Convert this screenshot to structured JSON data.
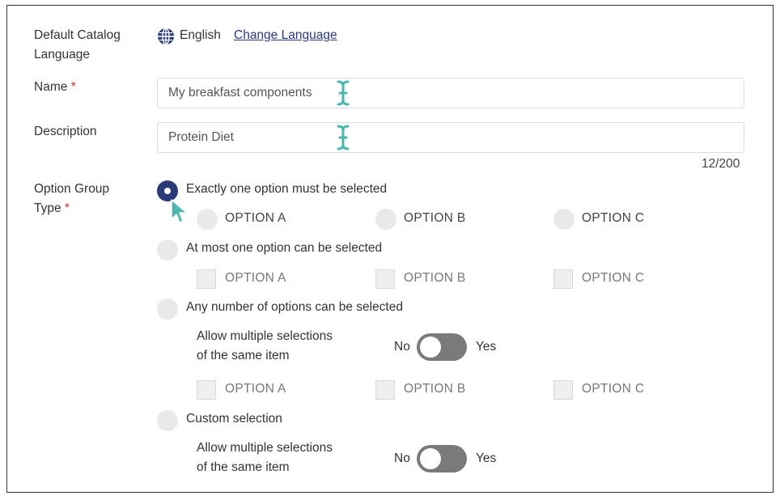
{
  "catalog_language": {
    "label_line1": "Default Catalog",
    "label_line2": "Language",
    "value": "English",
    "change_link": "Change Language"
  },
  "name": {
    "label": "Name",
    "required_mark": "*",
    "value": "My breakfast components"
  },
  "description": {
    "label": "Description",
    "value": "Protein Diet",
    "counter": "12/200"
  },
  "option_group_type": {
    "label_line1": "Option Group",
    "label_line2": "Type",
    "required_mark": "*",
    "choices": [
      {
        "label": "Exactly one option must be selected",
        "selected": true,
        "options": [
          "OPTION A",
          "OPTION B",
          "OPTION C"
        ]
      },
      {
        "label": "At most one option can be selected",
        "selected": false,
        "options": [
          "OPTION A",
          "OPTION B",
          "OPTION C"
        ]
      },
      {
        "label": "Any number of options can be selected",
        "selected": false,
        "multi_line1": "Allow multiple selections",
        "multi_line2": "of the same item",
        "toggle_no": "No",
        "toggle_yes": "Yes",
        "toggle_on": false,
        "options": [
          "OPTION A",
          "OPTION B",
          "OPTION C"
        ]
      },
      {
        "label": "Custom selection",
        "selected": false,
        "multi_line1": "Allow multiple selections",
        "multi_line2": "of the same item",
        "toggle_no": "No",
        "toggle_yes": "Yes",
        "toggle_on": false
      }
    ]
  },
  "colors": {
    "accent": "#2a3a78",
    "required": "#d32f2f",
    "cursor": "#4bb8ad"
  }
}
